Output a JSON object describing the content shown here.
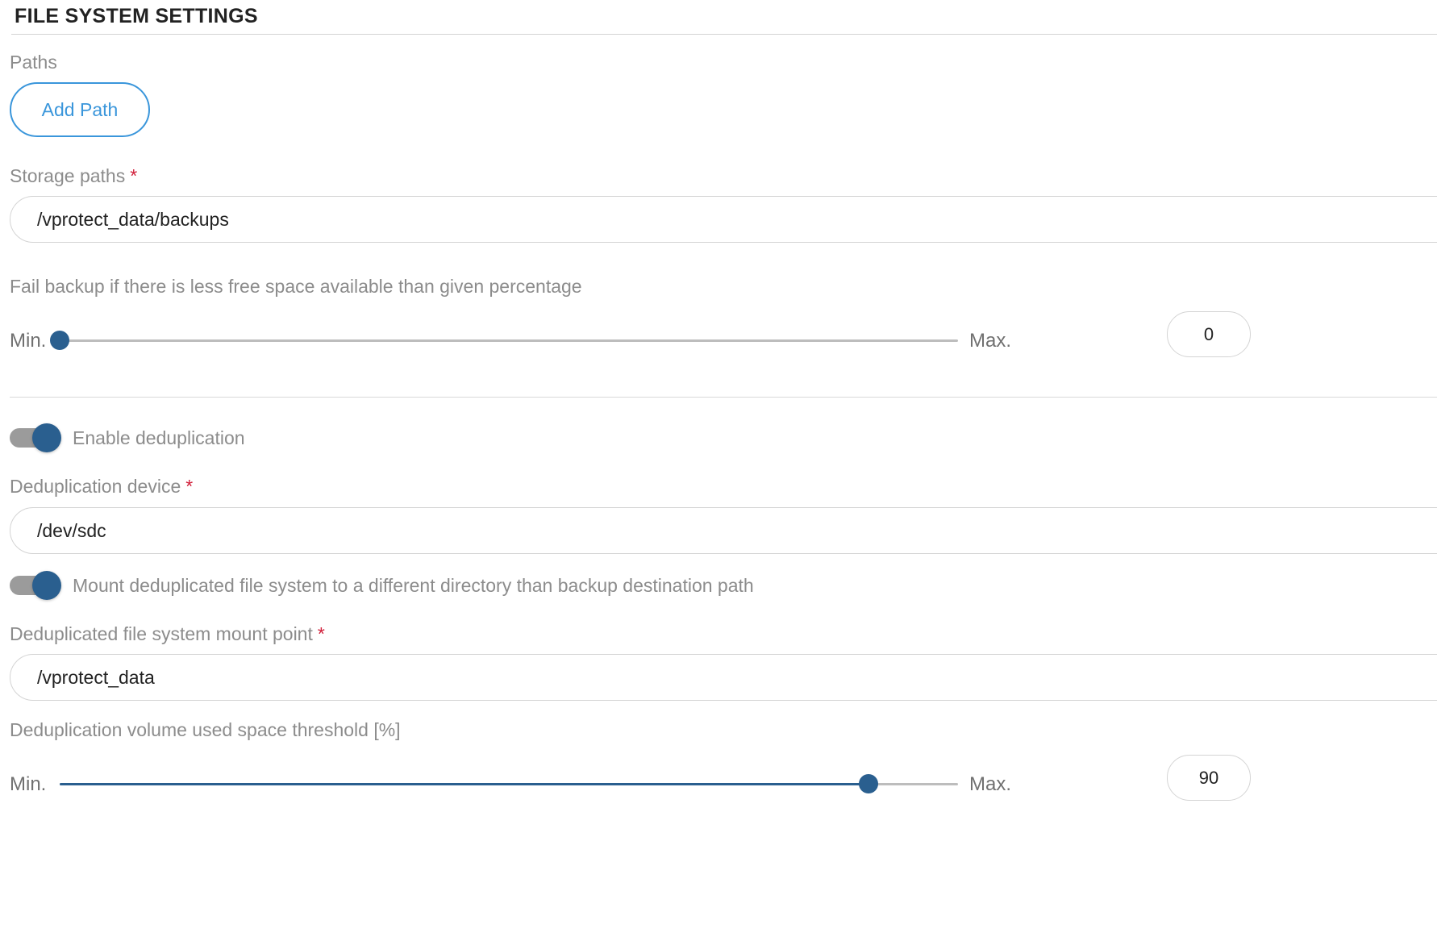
{
  "section": {
    "title": "FILE SYSTEM SETTINGS"
  },
  "paths": {
    "label": "Paths",
    "add_button": "Add Path"
  },
  "storage_paths": {
    "label": "Storage paths",
    "required_mark": "*",
    "value": "/vprotect_data/backups"
  },
  "free_space_slider": {
    "label": "Fail backup if there is less free space available than given percentage",
    "min_label": "Min.",
    "max_label": "Max.",
    "value": "0",
    "fraction": 0.0
  },
  "dedup_toggle": {
    "label": "Enable deduplication",
    "checked": true
  },
  "dedup_device": {
    "label": "Deduplication device",
    "required_mark": "*",
    "value": "/dev/sdc"
  },
  "mount_toggle": {
    "label": "Mount deduplicated file system to a different directory than backup destination path",
    "checked": true
  },
  "mount_point": {
    "label": "Deduplicated file system mount point",
    "required_mark": "*",
    "value": "/vprotect_data"
  },
  "threshold_slider": {
    "label": "Deduplication volume used space threshold [%]",
    "min_label": "Min.",
    "max_label": "Max.",
    "value": "90",
    "fraction": 0.9
  },
  "colors": {
    "accent": "#2a5f8f",
    "button_outline": "#3a96db",
    "required": "#d11f3a",
    "label": "#8c8c8c"
  }
}
